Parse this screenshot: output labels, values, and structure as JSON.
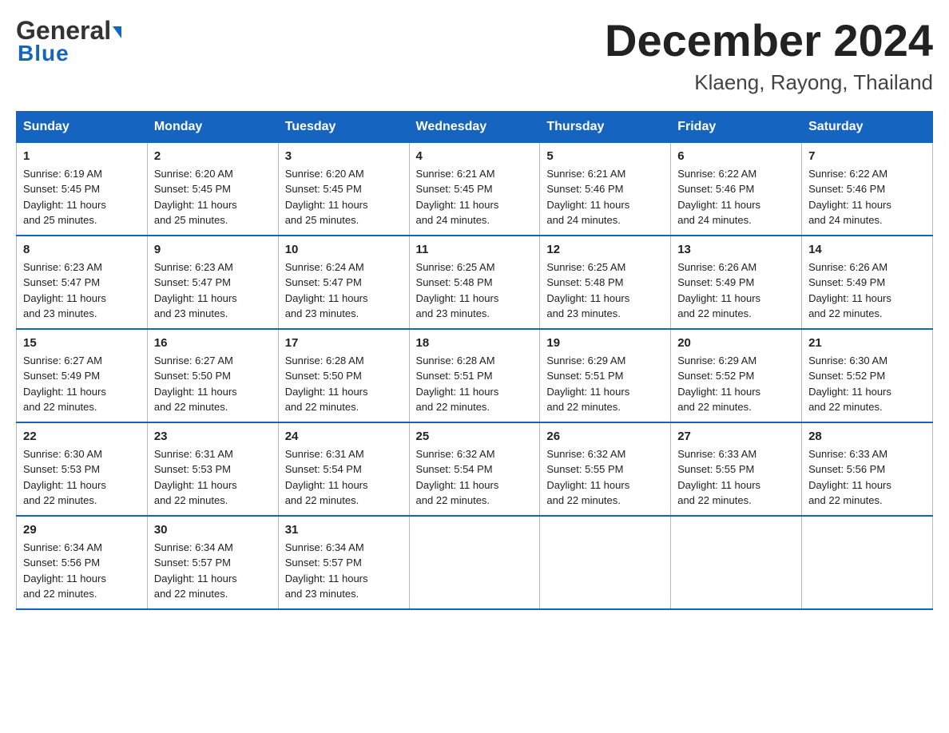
{
  "header": {
    "logo_general": "General",
    "logo_blue": "Blue",
    "month_title": "December 2024",
    "location": "Klaeng, Rayong, Thailand"
  },
  "weekdays": [
    "Sunday",
    "Monday",
    "Tuesday",
    "Wednesday",
    "Thursday",
    "Friday",
    "Saturday"
  ],
  "weeks": [
    [
      {
        "day": "1",
        "sunrise": "6:19 AM",
        "sunset": "5:45 PM",
        "daylight": "11 hours and 25 minutes."
      },
      {
        "day": "2",
        "sunrise": "6:20 AM",
        "sunset": "5:45 PM",
        "daylight": "11 hours and 25 minutes."
      },
      {
        "day": "3",
        "sunrise": "6:20 AM",
        "sunset": "5:45 PM",
        "daylight": "11 hours and 25 minutes."
      },
      {
        "day": "4",
        "sunrise": "6:21 AM",
        "sunset": "5:45 PM",
        "daylight": "11 hours and 24 minutes."
      },
      {
        "day": "5",
        "sunrise": "6:21 AM",
        "sunset": "5:46 PM",
        "daylight": "11 hours and 24 minutes."
      },
      {
        "day": "6",
        "sunrise": "6:22 AM",
        "sunset": "5:46 PM",
        "daylight": "11 hours and 24 minutes."
      },
      {
        "day": "7",
        "sunrise": "6:22 AM",
        "sunset": "5:46 PM",
        "daylight": "11 hours and 24 minutes."
      }
    ],
    [
      {
        "day": "8",
        "sunrise": "6:23 AM",
        "sunset": "5:47 PM",
        "daylight": "11 hours and 23 minutes."
      },
      {
        "day": "9",
        "sunrise": "6:23 AM",
        "sunset": "5:47 PM",
        "daylight": "11 hours and 23 minutes."
      },
      {
        "day": "10",
        "sunrise": "6:24 AM",
        "sunset": "5:47 PM",
        "daylight": "11 hours and 23 minutes."
      },
      {
        "day": "11",
        "sunrise": "6:25 AM",
        "sunset": "5:48 PM",
        "daylight": "11 hours and 23 minutes."
      },
      {
        "day": "12",
        "sunrise": "6:25 AM",
        "sunset": "5:48 PM",
        "daylight": "11 hours and 23 minutes."
      },
      {
        "day": "13",
        "sunrise": "6:26 AM",
        "sunset": "5:49 PM",
        "daylight": "11 hours and 22 minutes."
      },
      {
        "day": "14",
        "sunrise": "6:26 AM",
        "sunset": "5:49 PM",
        "daylight": "11 hours and 22 minutes."
      }
    ],
    [
      {
        "day": "15",
        "sunrise": "6:27 AM",
        "sunset": "5:49 PM",
        "daylight": "11 hours and 22 minutes."
      },
      {
        "day": "16",
        "sunrise": "6:27 AM",
        "sunset": "5:50 PM",
        "daylight": "11 hours and 22 minutes."
      },
      {
        "day": "17",
        "sunrise": "6:28 AM",
        "sunset": "5:50 PM",
        "daylight": "11 hours and 22 minutes."
      },
      {
        "day": "18",
        "sunrise": "6:28 AM",
        "sunset": "5:51 PM",
        "daylight": "11 hours and 22 minutes."
      },
      {
        "day": "19",
        "sunrise": "6:29 AM",
        "sunset": "5:51 PM",
        "daylight": "11 hours and 22 minutes."
      },
      {
        "day": "20",
        "sunrise": "6:29 AM",
        "sunset": "5:52 PM",
        "daylight": "11 hours and 22 minutes."
      },
      {
        "day": "21",
        "sunrise": "6:30 AM",
        "sunset": "5:52 PM",
        "daylight": "11 hours and 22 minutes."
      }
    ],
    [
      {
        "day": "22",
        "sunrise": "6:30 AM",
        "sunset": "5:53 PM",
        "daylight": "11 hours and 22 minutes."
      },
      {
        "day": "23",
        "sunrise": "6:31 AM",
        "sunset": "5:53 PM",
        "daylight": "11 hours and 22 minutes."
      },
      {
        "day": "24",
        "sunrise": "6:31 AM",
        "sunset": "5:54 PM",
        "daylight": "11 hours and 22 minutes."
      },
      {
        "day": "25",
        "sunrise": "6:32 AM",
        "sunset": "5:54 PM",
        "daylight": "11 hours and 22 minutes."
      },
      {
        "day": "26",
        "sunrise": "6:32 AM",
        "sunset": "5:55 PM",
        "daylight": "11 hours and 22 minutes."
      },
      {
        "day": "27",
        "sunrise": "6:33 AM",
        "sunset": "5:55 PM",
        "daylight": "11 hours and 22 minutes."
      },
      {
        "day": "28",
        "sunrise": "6:33 AM",
        "sunset": "5:56 PM",
        "daylight": "11 hours and 22 minutes."
      }
    ],
    [
      {
        "day": "29",
        "sunrise": "6:34 AM",
        "sunset": "5:56 PM",
        "daylight": "11 hours and 22 minutes."
      },
      {
        "day": "30",
        "sunrise": "6:34 AM",
        "sunset": "5:57 PM",
        "daylight": "11 hours and 22 minutes."
      },
      {
        "day": "31",
        "sunrise": "6:34 AM",
        "sunset": "5:57 PM",
        "daylight": "11 hours and 23 minutes."
      },
      null,
      null,
      null,
      null
    ]
  ],
  "labels": {
    "sunrise": "Sunrise:",
    "sunset": "Sunset:",
    "daylight": "Daylight:"
  },
  "colors": {
    "header_bg": "#1565c0",
    "header_text": "#ffffff",
    "border": "#bbbbbb",
    "week_border": "#1565c0"
  }
}
